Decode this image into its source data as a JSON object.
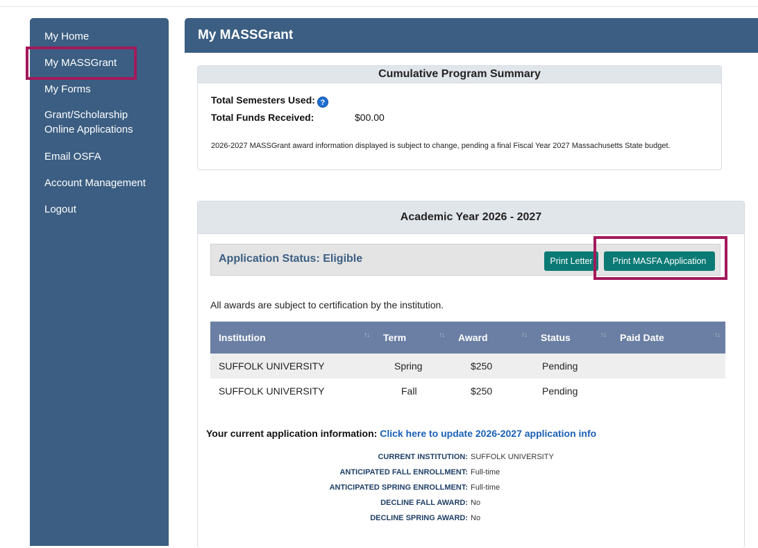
{
  "sidebar": {
    "items": [
      {
        "label": "My Home"
      },
      {
        "label": "My MASSGrant"
      },
      {
        "label": "My Forms"
      },
      {
        "label": "Grant/Scholarship"
      },
      {
        "label": "Online Applications"
      },
      {
        "label": "Email OSFA"
      },
      {
        "label": "Account Management"
      },
      {
        "label": "Logout"
      }
    ]
  },
  "page": {
    "title": "My MASSGrant"
  },
  "summary": {
    "heading": "Cumulative Program Summary",
    "semesters_label": "Total Semesters Used:",
    "help_glyph": "?",
    "funds_label": "Total Funds Received:",
    "funds_value": "$00.00",
    "disclaimer": "2026-2027 MASSGrant award information displayed is subject to change, pending a final Fiscal Year 2027 Massachusetts State budget."
  },
  "academic": {
    "heading": "Academic Year 2026 - 2027",
    "status": "Application Status: Eligible",
    "print_letter": "Print Letter",
    "print_masfa": "Print MASFA Application",
    "note": "All awards are subject to certification by the institution.",
    "sort_glyph": "↑↓",
    "columns": [
      "Institution",
      "Term",
      "Award",
      "Status",
      "Paid Date"
    ],
    "rows": [
      {
        "institution": "SUFFOLK UNIVERSITY",
        "term": "Spring",
        "award": "$250",
        "status": "Pending",
        "paid_date": ""
      },
      {
        "institution": "SUFFOLK UNIVERSITY",
        "term": "Fall",
        "award": "$250",
        "status": "Pending",
        "paid_date": ""
      }
    ],
    "appinfo_label": "Your current application information:",
    "appinfo_link": "Click here to update 2026-2027 application info",
    "info": [
      {
        "label": "CURRENT INSTITUTION:",
        "value": "SUFFOLK UNIVERSITY"
      },
      {
        "label": "ANTICIPATED FALL ENROLLMENT:",
        "value": "Full-time"
      },
      {
        "label": "ANTICIPATED SPRING ENROLLMENT:",
        "value": "Full-time"
      },
      {
        "label": "DECLINE FALL AWARD:",
        "value": "No"
      },
      {
        "label": "DECLINE SPRING AWARD:",
        "value": "No"
      }
    ]
  },
  "colors": {
    "nav_blue": "#3b5e82",
    "table_header": "#6a7fa3",
    "button_teal": "#0b7a75",
    "highlight": "#a3195b",
    "link_blue": "#1a5fb4"
  }
}
